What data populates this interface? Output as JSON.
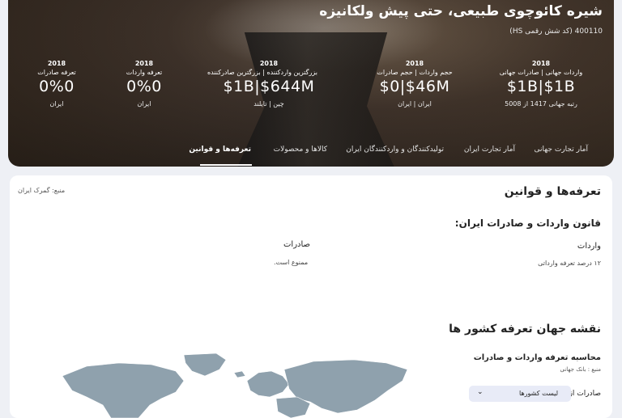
{
  "hero": {
    "title": "شیره کائوچوی طبیعی، حتی پیش ولکانیزه",
    "hs_code": "400110 (کد شش رقمی HS)",
    "stats": [
      {
        "year": "2018",
        "label": "واردات جهانی | صادرات جهانی",
        "value": "$1B|$1B",
        "sub": "رتبه جهانی 1417 از 5008"
      },
      {
        "year": "2018",
        "label": "حجم واردات | حجم صادرات",
        "value": "$0|$46M",
        "sub": "ایران | ایران"
      },
      {
        "year": "2018",
        "label": "بزرگترین واردکننده | بزرگترین صادرکننده",
        "value": "$1B|$644M",
        "sub": "چین | تایلند"
      },
      {
        "year": "2018",
        "label": "تعرفه واردات",
        "value": "0%0",
        "sub": "ایران"
      },
      {
        "year": "2018",
        "label": "تعرفه صادرات",
        "value": "0%0",
        "sub": "ایران"
      }
    ]
  },
  "tabs": [
    {
      "label": "آمار تجارت جهانی",
      "active": false
    },
    {
      "label": "آمار تجارت ایران",
      "active": false
    },
    {
      "label": "تولیدکنندگان و واردکنندگان ایران",
      "active": false
    },
    {
      "label": "کالاها و محصولات",
      "active": false
    },
    {
      "label": "تعرفه‌ها و قوانین",
      "active": true
    }
  ],
  "section": {
    "title": "تعرفه‌ها و قوانین",
    "source": "منبع: گمرک ایران"
  },
  "law": {
    "title": "قانون واردات و صادرات ایران:",
    "imports_label": "واردات",
    "imports_value": "۱۲ درصد تعرفه وارداتی",
    "exports_label": "صادرات",
    "exports_value": "ممنوع است."
  },
  "map_section": {
    "title": "نقشه جهان تعرفه کشور ها",
    "calc_title": "محاسبه تعرفه واردات و صادرات",
    "calc_source": "منبع : بانک جهانی",
    "exports_from_label": "صادرات از",
    "country_select_value": "لیست کشورها",
    "map_color": "#8fa1ad"
  }
}
